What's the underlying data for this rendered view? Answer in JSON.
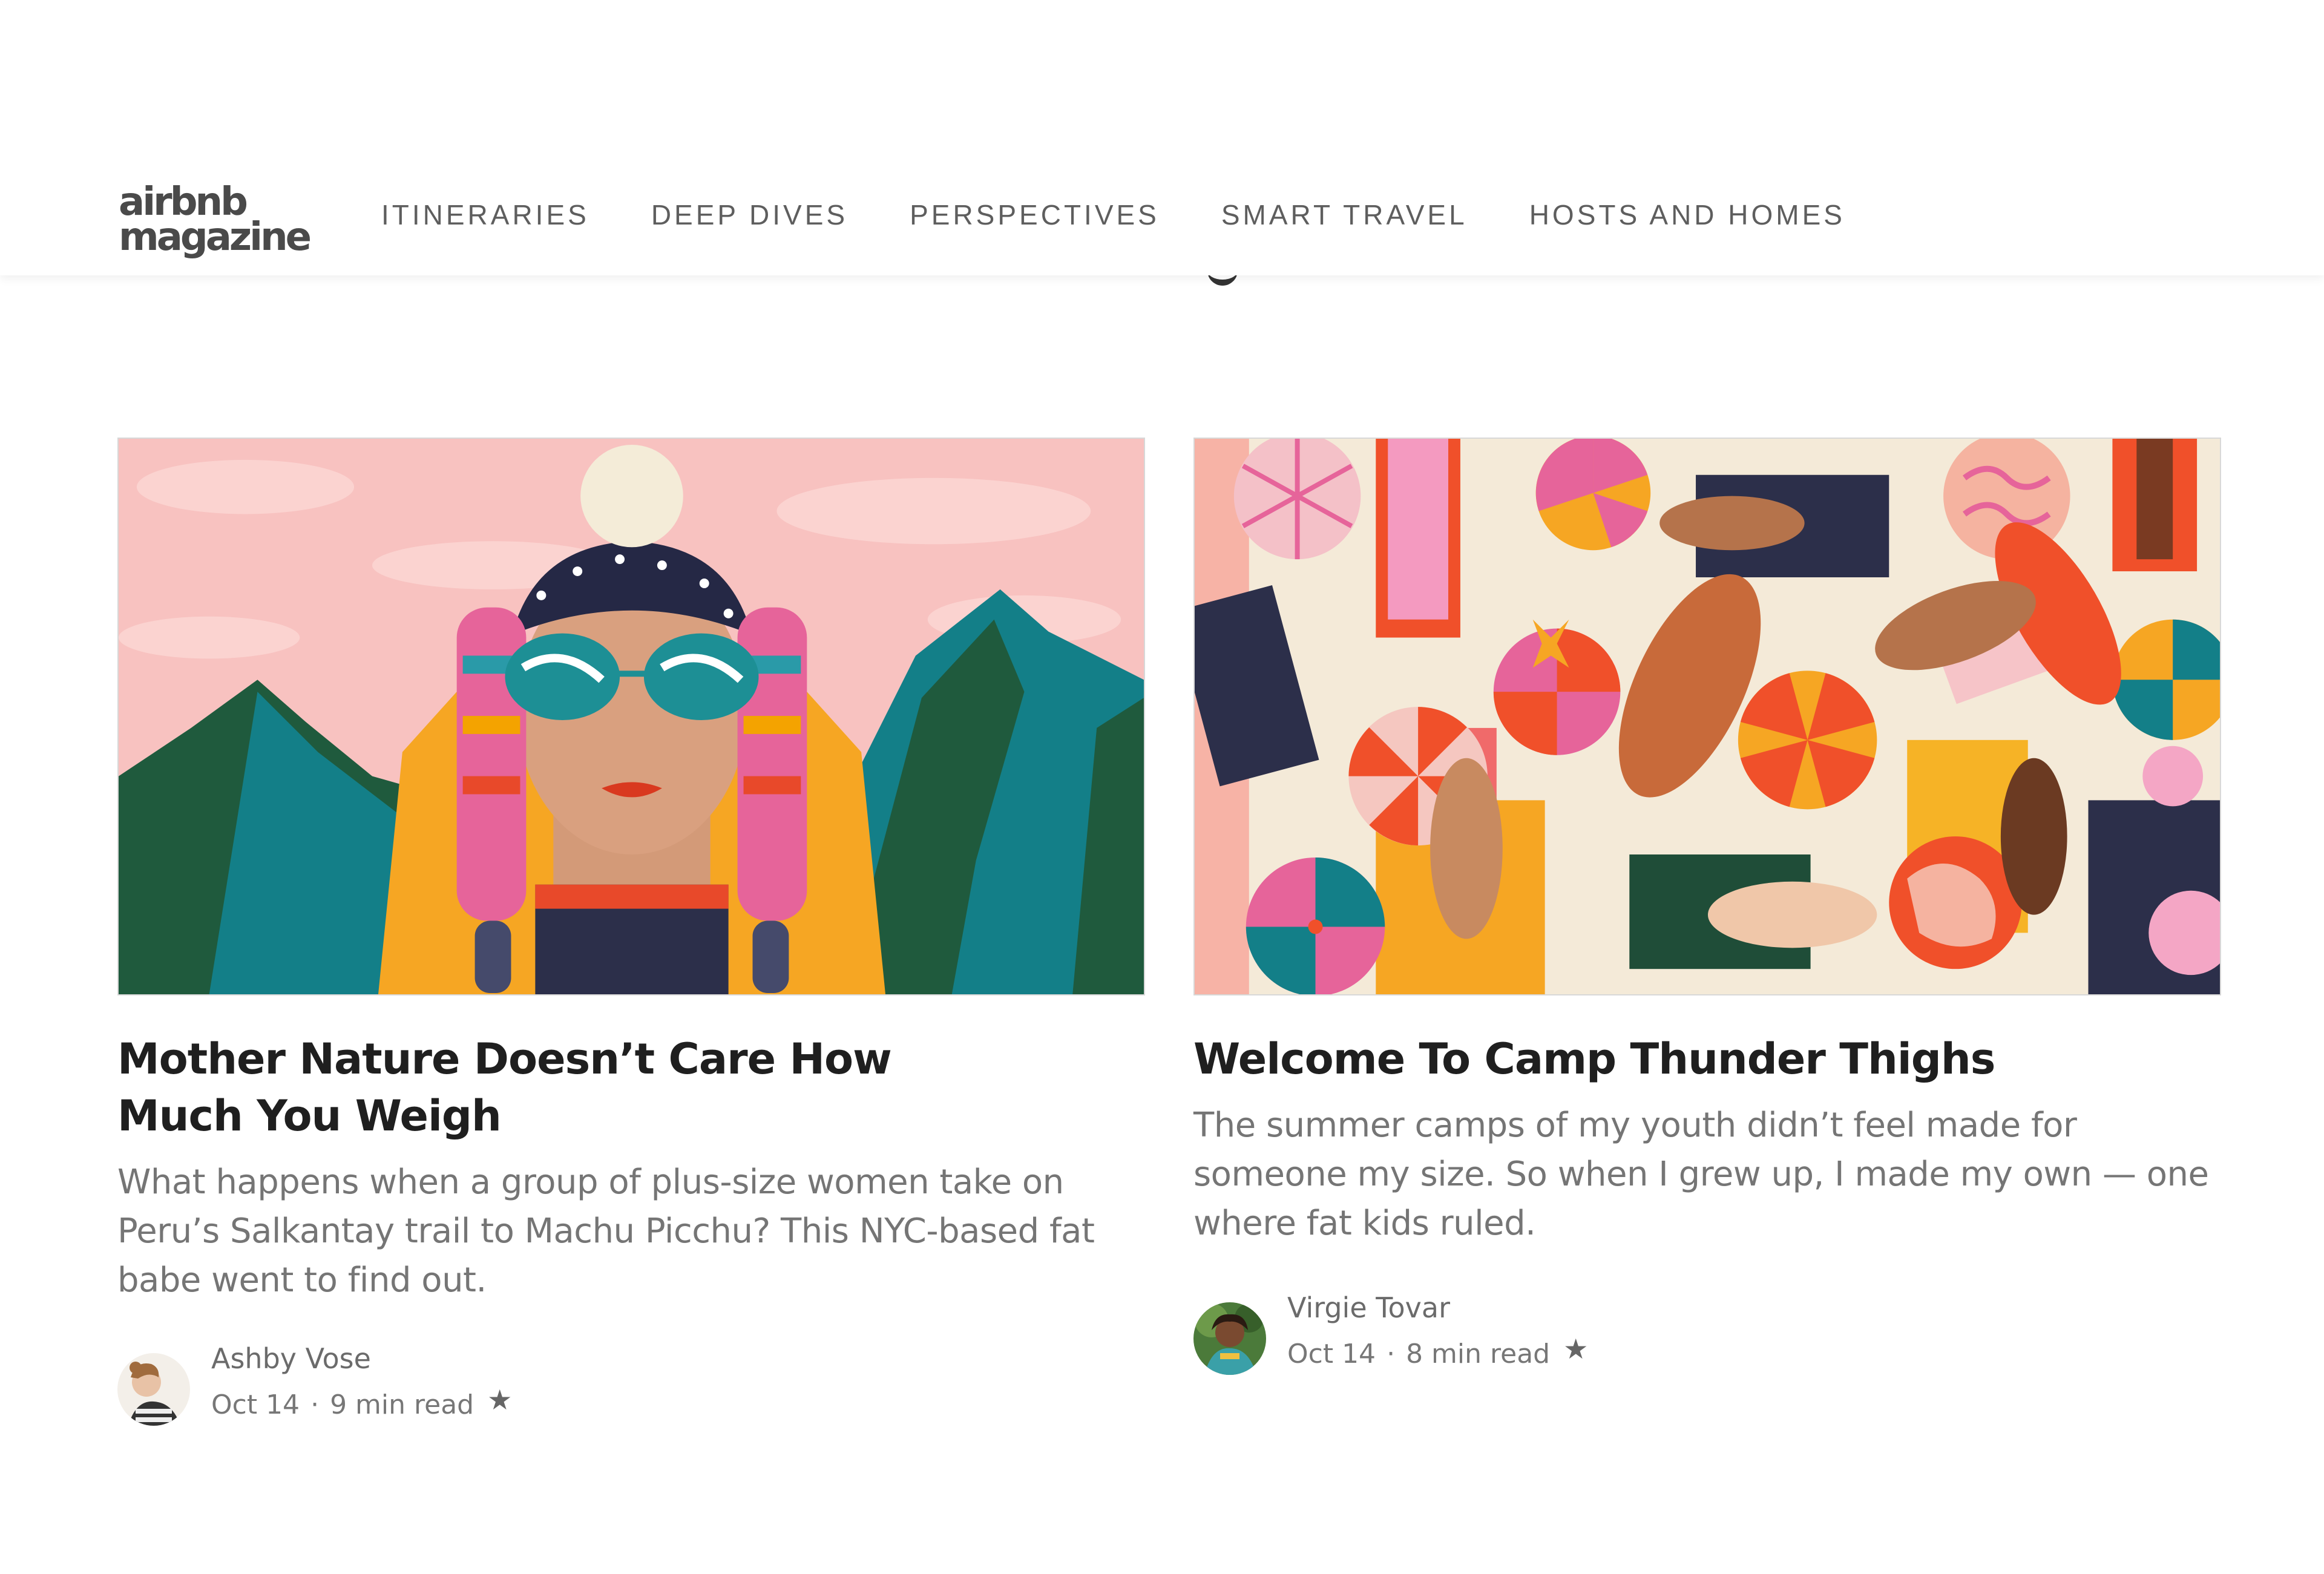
{
  "header": {
    "logo_line1": "airbnb",
    "logo_line2": "magazine",
    "nav": [
      {
        "label": "ITINERARIES"
      },
      {
        "label": "DEEP DIVES"
      },
      {
        "label": "PERSPECTIVES"
      },
      {
        "label": "SMART TRAVEL"
      },
      {
        "label": "HOSTS AND HOMES"
      }
    ]
  },
  "articles": [
    {
      "title": "Mother Nature Doesn’t Care How Much You Weigh",
      "excerpt": "What happens when a group of plus-size women take on Peru’s Salkantay trail to Machu Picchu? This NYC-based fat babe went to find out.",
      "author": "Ashby Vose",
      "date": "Oct 14",
      "separator": "·",
      "read_time": "9 min read",
      "bookmark_icon": "star-icon"
    },
    {
      "title": "Welcome To Camp Thunder Thighs",
      "excerpt": "The summer camps of my youth didn’t feel made for someone my size. So when I grew up, I made my own — one where fat kids ruled.",
      "author": "Virgie Tovar",
      "date": "Oct 14",
      "separator": "·",
      "read_time": "8 min read",
      "bookmark_icon": "star-icon"
    }
  ],
  "colors": {
    "title": "#1f1f1f",
    "excerpt": "#757575",
    "nav": "#5e5e5e"
  }
}
